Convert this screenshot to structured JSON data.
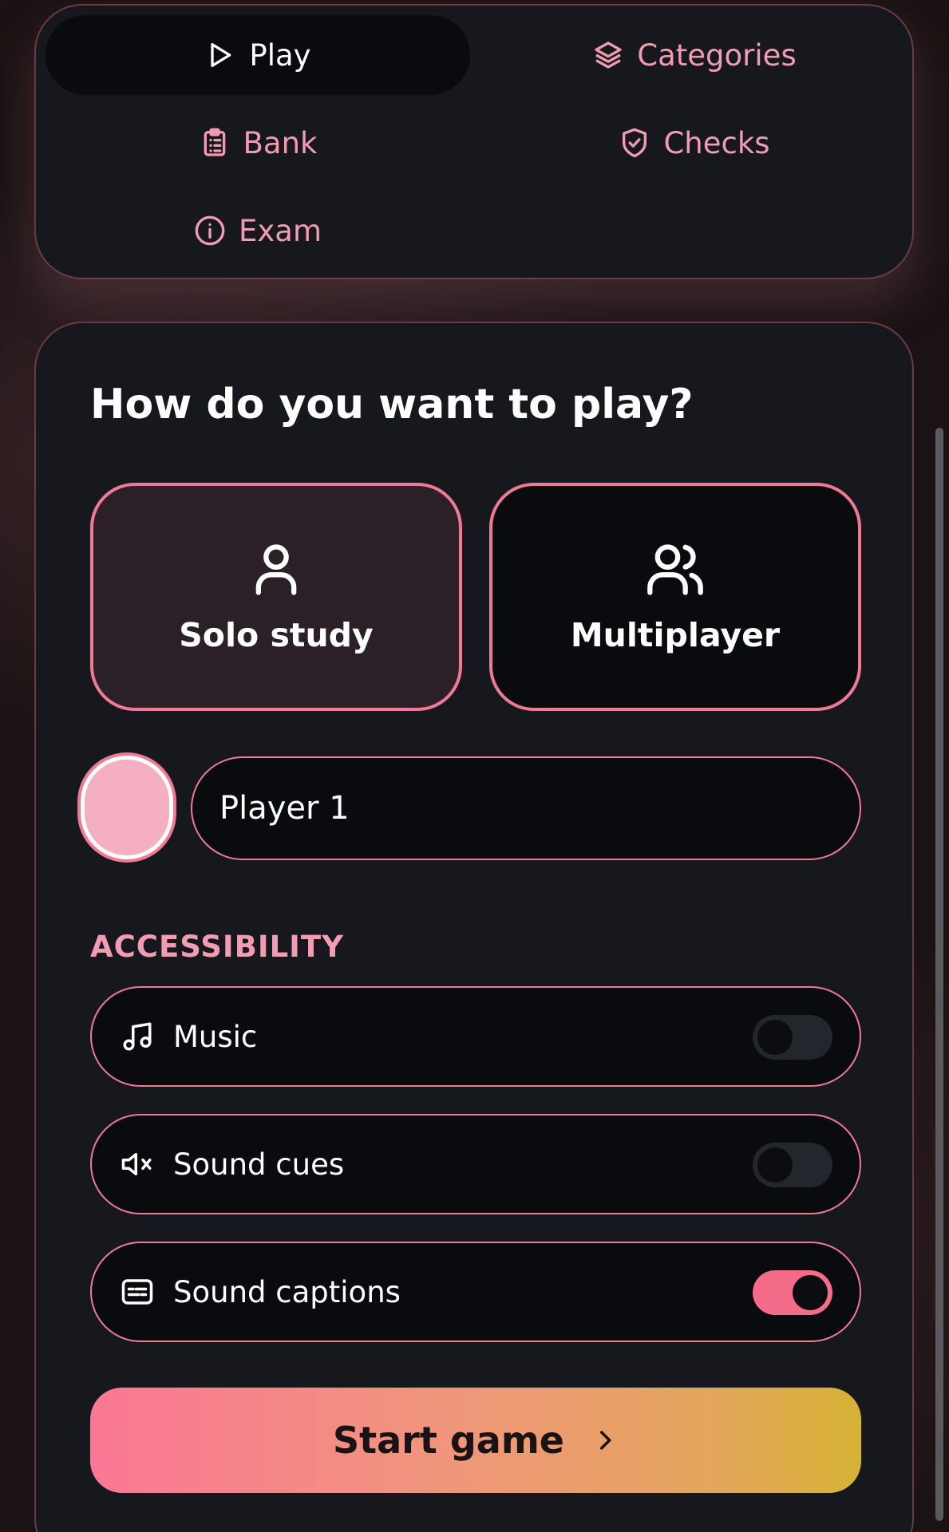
{
  "nav": {
    "items": [
      {
        "label": "Play",
        "icon": "play-icon",
        "active": true
      },
      {
        "label": "Categories",
        "icon": "layers-icon",
        "active": false
      },
      {
        "label": "Bank",
        "icon": "clipboard-icon",
        "active": false
      },
      {
        "label": "Checks",
        "icon": "shield-check-icon",
        "active": false
      },
      {
        "label": "Exam",
        "icon": "info-icon",
        "active": false
      }
    ]
  },
  "setup": {
    "heading": "How do you want to play?",
    "modes": [
      {
        "label": "Solo study",
        "icon": "user-icon",
        "selected": true
      },
      {
        "label": "Multiplayer",
        "icon": "users-icon",
        "selected": false
      }
    ],
    "player_name": "Player 1",
    "avatar_color": "#f4afc0"
  },
  "accessibility": {
    "label": "ACCESSIBILITY",
    "options": [
      {
        "label": "Music",
        "icon": "music-icon",
        "enabled": false
      },
      {
        "label": "Sound cues",
        "icon": "volume-mute-icon",
        "enabled": false
      },
      {
        "label": "Sound captions",
        "icon": "captions-icon",
        "enabled": true
      }
    ]
  },
  "start_button": {
    "label": "Start game",
    "icon": "chevron-right-icon"
  },
  "colors": {
    "accent": "#f07a96",
    "accent_text": "#f29bb1",
    "card_bg": "#16181d",
    "toggle_on": "#f56b8a",
    "gradient_start": "#fb7795",
    "gradient_end": "#d6b234"
  }
}
